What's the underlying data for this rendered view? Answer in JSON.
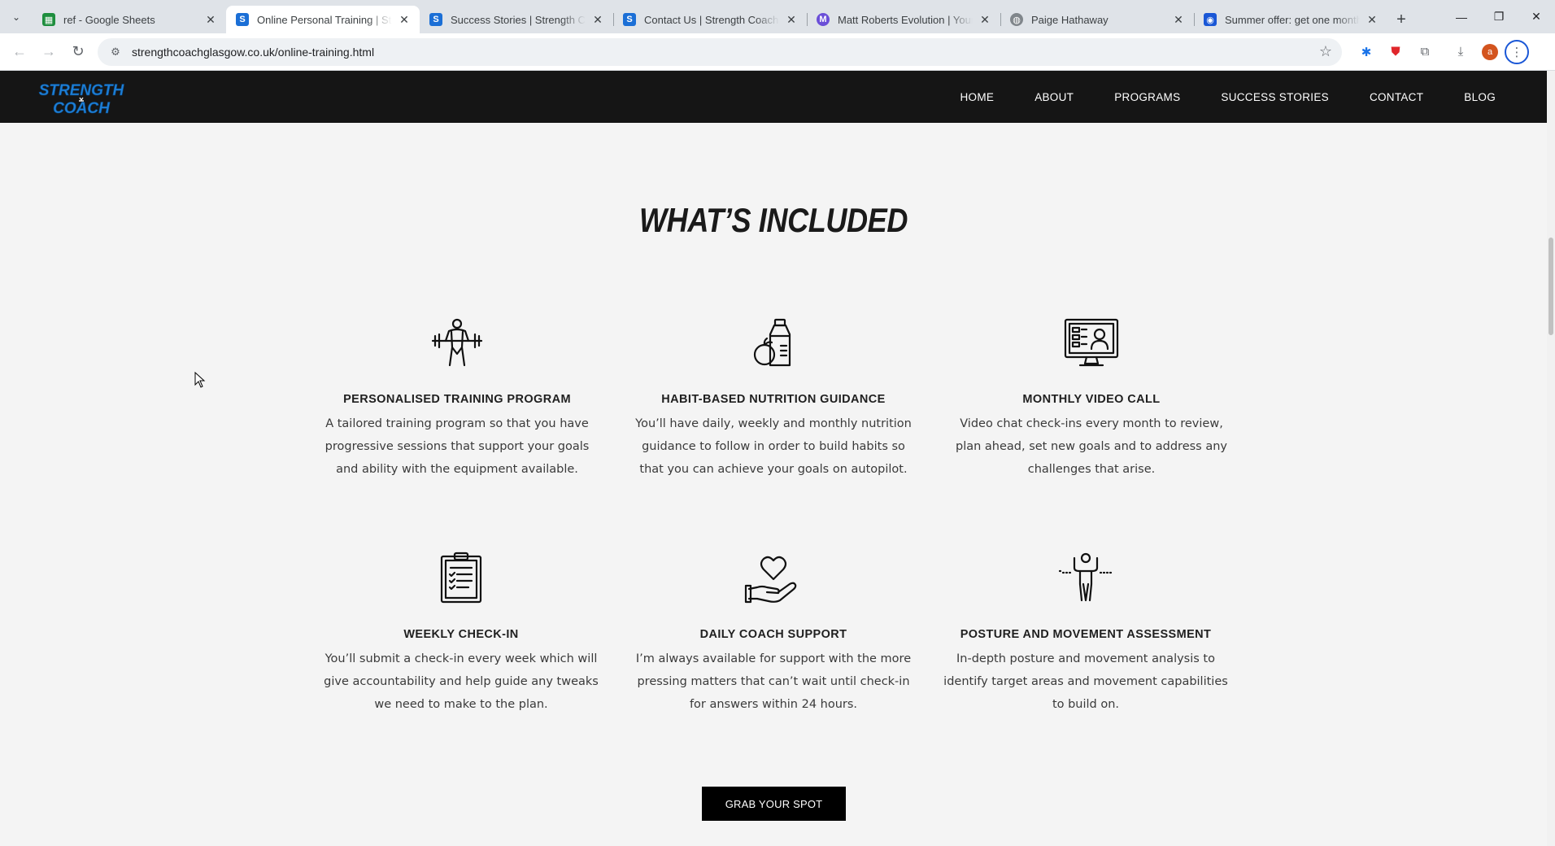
{
  "browser": {
    "tabs": [
      {
        "title": "ref - Google Sheets",
        "favicon": "sheets-icon",
        "color": "#1e8e3e",
        "glyph": "▦"
      },
      {
        "title": "Online Personal Training | Strength Coach Glasgow",
        "favicon": "strength-coach-icon",
        "color": "#1b6fd6",
        "glyph": "S"
      },
      {
        "title": "Success Stories | Strength Coach Glasgow",
        "favicon": "strength-coach-icon",
        "color": "#1b6fd6",
        "glyph": "S"
      },
      {
        "title": "Contact Us | Strength Coach Glasgow",
        "favicon": "strength-coach-icon",
        "color": "#1b6fd6",
        "glyph": "S"
      },
      {
        "title": "Matt Roberts Evolution | Younger",
        "favicon": "matt-roberts-icon",
        "color": "#6b4fd8",
        "glyph": "M"
      },
      {
        "title": "Paige Hathaway",
        "favicon": "globe-icon",
        "color": "#5f6368",
        "glyph": "◍"
      },
      {
        "title": "Summer offer: get one month free",
        "favicon": "offer-icon",
        "color": "#1a57d6",
        "glyph": "◉"
      }
    ],
    "active_tab": 1,
    "url": "strengthcoachglasgow.co.uk/online-training.html"
  },
  "site": {
    "logo": {
      "line1": "STRENGTH",
      "line2": "COACH",
      "color": "#1e7fd6"
    },
    "nav": [
      "HOME",
      "ABOUT",
      "PROGRAMS",
      "SUCCESS STORIES",
      "CONTACT",
      "BLOG"
    ],
    "section_title": "WHAT’S INCLUDED",
    "features": [
      {
        "icon": "weightlifter-icon",
        "title": "PERSONALISED TRAINING PROGRAM",
        "desc": "A tailored training program so that you have progressive sessions that support your goals and ability with the equipment available."
      },
      {
        "icon": "nutrition-icon",
        "title": "HABIT-BASED NUTRITION GUIDANCE",
        "desc": "You’ll have daily, weekly and monthly nutrition guidance to follow in order to build habits so that you can achieve your goals on autopilot."
      },
      {
        "icon": "video-call-icon",
        "title": "MONTHLY VIDEO CALL",
        "desc": "Video chat check-ins every month to review, plan ahead, set new goals and to address any challenges that arise."
      },
      {
        "icon": "clipboard-icon",
        "title": "WEEKLY CHECK-IN",
        "desc": "You’ll submit a check-in every week which will give accountability and help guide any tweaks we need to make to the plan."
      },
      {
        "icon": "heart-hand-icon",
        "title": "DAILY COACH SUPPORT",
        "desc": "I’m always available for support with the more pressing matters that can’t wait until check-in for answers within 24 hours."
      },
      {
        "icon": "posture-icon",
        "title": "POSTURE AND MOVEMENT ASSESSMENT",
        "desc": "In-depth posture and movement analysis to identify target areas and movement capabilities to build on."
      }
    ],
    "cta_label": "GRAB YOUR SPOT"
  }
}
